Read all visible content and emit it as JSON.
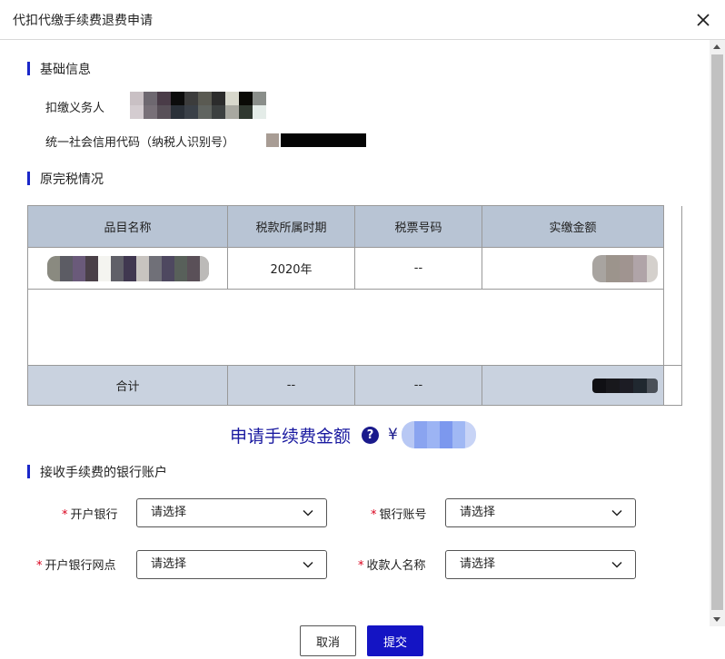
{
  "dialog": {
    "title": "代扣代缴手续费退费申请"
  },
  "basic_info": {
    "heading": "基础信息",
    "withholder_label": "扣缴义务人",
    "credit_code_label": "统一社会信用代码（纳税人识别号）"
  },
  "tax_section": {
    "heading": "原完税情况",
    "columns": [
      "品目名称",
      "税款所属时期",
      "税票号码",
      "实缴金额"
    ],
    "row": {
      "period": "2020年",
      "ticket_no": "--"
    },
    "total": {
      "label": "合计",
      "period": "--",
      "ticket_no": "--"
    }
  },
  "fee": {
    "label": "申请手续费金额",
    "help_icon": "?",
    "currency": "¥"
  },
  "bank_section": {
    "heading": "接收手续费的银行账户",
    "required_mark": "*",
    "bank_label": "开户银行",
    "account_label": "银行账号",
    "branch_label": "开户银行网点",
    "payee_label": "收款人名称",
    "bank_value": "请选择",
    "account_value": "请选择",
    "branch_value": "请选择",
    "payee_value": "请选择"
  },
  "actions": {
    "cancel_label": "取消",
    "submit_label": "提交"
  },
  "colors": {
    "accent": "#1414c4",
    "header_bg": "#b8c4d4",
    "total_bg": "#c9d2df",
    "required": "#d9001b"
  }
}
